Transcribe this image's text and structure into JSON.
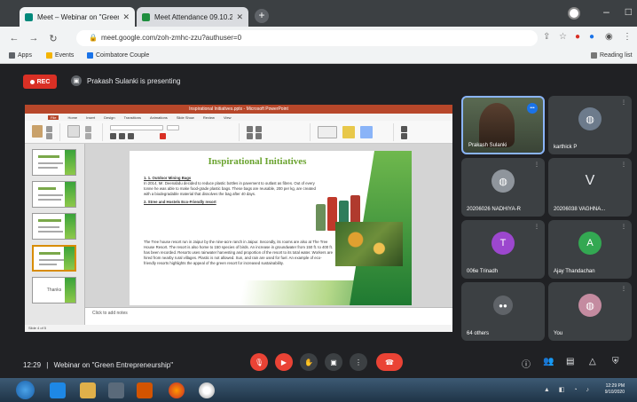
{
  "browser": {
    "tabs": [
      {
        "title": "Meet – Webinar on \"Green",
        "active": true
      },
      {
        "title": "Meet Attendance 09.10.2020 – ",
        "active": false
      }
    ],
    "url": "meet.google.com/zoh-zmhc-zzu?authuser=0",
    "bookmarks": [
      "Apps",
      "Events",
      "Coimbatore Couple"
    ],
    "bookmark_right": "Reading list"
  },
  "meet": {
    "rec_label": "REC",
    "presenting_text": "Prakash Sulanki is presenting",
    "meeting_time": "12:29",
    "meeting_title": "Webinar on \"Green Entrepreneurship\""
  },
  "presentation": {
    "window_title": "Inspirational Initiatives.pptx - Microsoft PowerPoint",
    "ribbon_tabs": [
      "File",
      "Home",
      "Insert",
      "Design",
      "Transitions",
      "Animations",
      "Slide Show",
      "Review",
      "View"
    ],
    "slide_title": "Inspirational Initiatives",
    "bullet1_heading": "1. 1. Outdoor Mining Bags",
    "bullet1_text": "In 2014, Mr. Deenabdu decided to reduce plastic bottles in pavement to outlast as fibres. Out of every tonne he was able to make food-grade plastic bags. These bags are reusable, 200 per kg, are created with a biodegradable material that dissolves the bag after 40 days.",
    "bullet2_heading": "2. Stree and Hostels Eco-Friendly resort",
    "para": "The Tree house resort run in Jaipur by the nine-acre ranch in Jaipur. Secondly, its rooms are also at The Tree House Resort. The resort is also home to 150 species of birds. An increase in groundwater from 150 ft. to 400 ft. has been recorded. Resorts uses rainwater harvesting and proportion of the resort to its total water. Workers are hired from nearby rural villages. Plastic is not allowed. Sun, and rain are used for fuel. An example of eco-friendly resorts highlights the appeal of the green resort for increased sustainability.",
    "notes_placeholder": "Click to add notes",
    "thumb5_label": "Thanks",
    "status": "Slide 4 of 5"
  },
  "participants": [
    {
      "name": "Prakash Sulanki",
      "type": "video"
    },
    {
      "name": "karthick P",
      "type": "photo"
    },
    {
      "name": "20206026 NADHIYA-R",
      "type": "photo"
    },
    {
      "name": "20206038 VAGHNA...",
      "letter": "V",
      "type": "letter"
    },
    {
      "name": "006e Trinadh",
      "letter": "T",
      "color": "#9c47ce",
      "type": "avatar"
    },
    {
      "name": "Ajay Thandachan",
      "letter": "A",
      "color": "#33a852",
      "type": "avatar"
    },
    {
      "name": "64 others",
      "type": "others"
    },
    {
      "name": "You",
      "type": "self"
    }
  ],
  "taskbar": {
    "clock_time": "12:29 PM",
    "clock_date": "9/10/2020"
  },
  "colors": {
    "meet_bg": "#202124",
    "red": "#ea4335",
    "accent_blue": "#1a73e8"
  }
}
